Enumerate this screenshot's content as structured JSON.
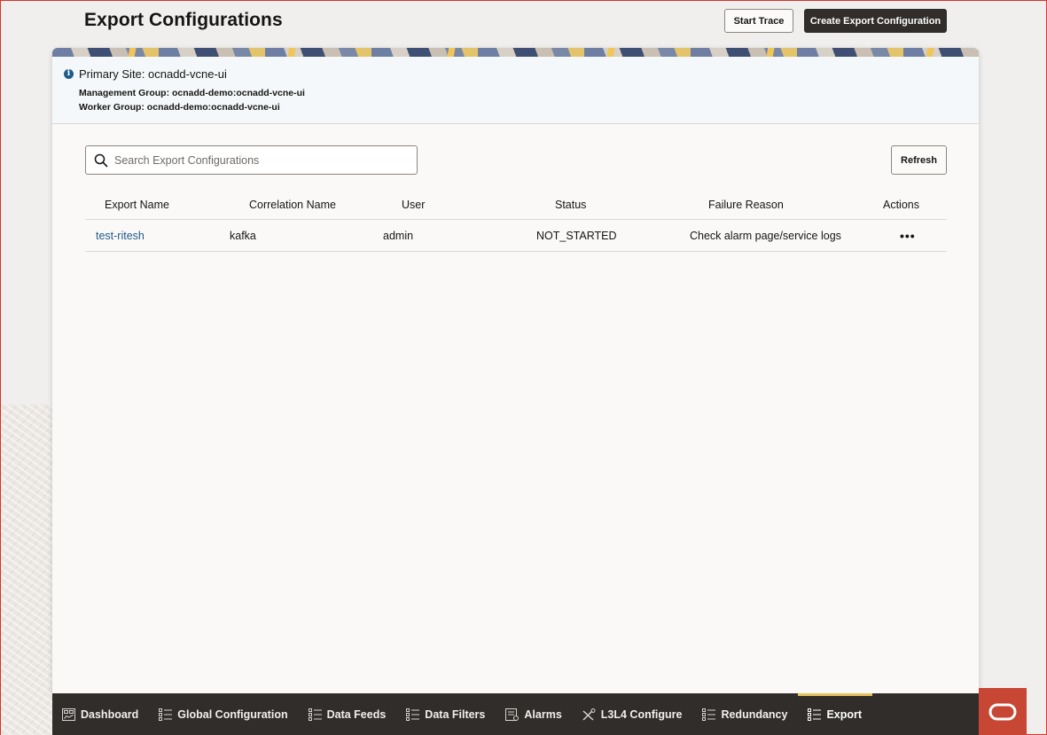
{
  "page": {
    "title": "Export Configurations",
    "start_trace_label": "Start Trace",
    "create_label": "Create Export Configuration"
  },
  "site_info": {
    "primary_site": "Primary Site: ocnadd-vcne-ui",
    "management_group": "Management Group: ocnadd-demo:ocnadd-vcne-ui",
    "worker_group": "Worker Group: ocnadd-demo:ocnadd-vcne-ui",
    "icon": "info-icon"
  },
  "search": {
    "placeholder": "Search Export Configurations",
    "value": "",
    "icon": "search-icon"
  },
  "refresh_label": "Refresh",
  "table": {
    "columns": [
      "Export Name",
      "Correlation Name",
      "User",
      "Status",
      "Failure Reason",
      "Actions"
    ],
    "rows": [
      {
        "export_name": "test-ritesh",
        "correlation_name": "kafka",
        "user": "admin",
        "status": "NOT_STARTED",
        "failure_reason": "Check alarm page/service logs",
        "actions": "•••"
      }
    ]
  },
  "nav": {
    "items": [
      {
        "label": "Dashboard",
        "icon": "dashboard-icon"
      },
      {
        "label": "Global Configuration",
        "icon": "list-icon"
      },
      {
        "label": "Data Feeds",
        "icon": "list-icon"
      },
      {
        "label": "Data Filters",
        "icon": "list-icon"
      },
      {
        "label": "Alarms",
        "icon": "alarm-icon"
      },
      {
        "label": "L3L4 Configure",
        "icon": "tools-icon"
      },
      {
        "label": "Redundancy",
        "icon": "list-icon"
      },
      {
        "label": "Export",
        "icon": "list-icon"
      }
    ],
    "active": "Export"
  },
  "colors": {
    "accent_dark": "#312d2a",
    "link": "#1e5c8a",
    "active_tab": "#e7c35b",
    "oracle_red": "#c74634"
  }
}
